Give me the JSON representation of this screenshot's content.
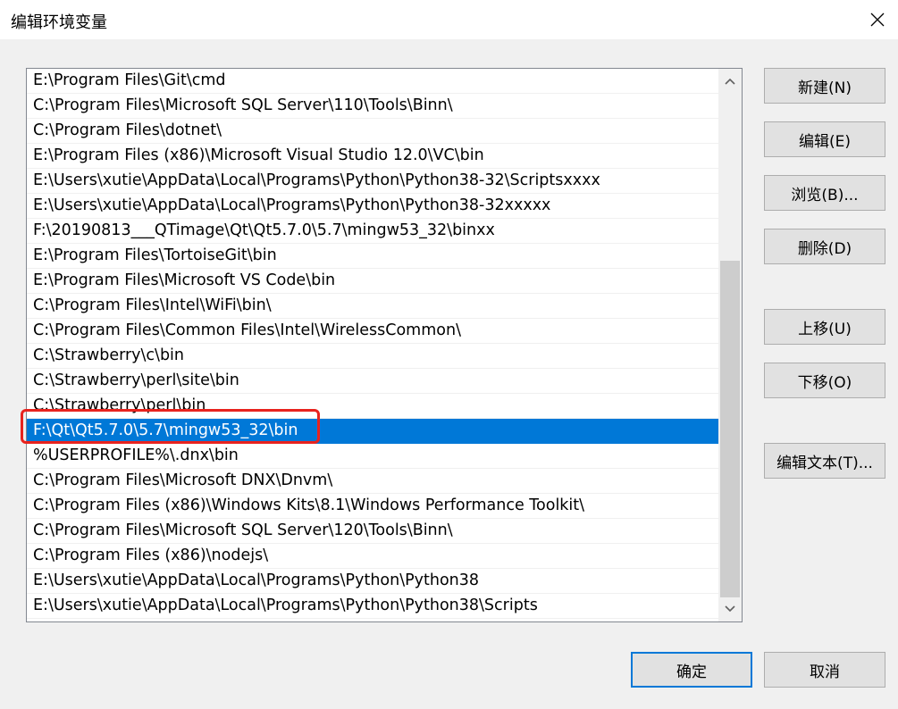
{
  "window": {
    "title": "编辑环境变量"
  },
  "list": {
    "items": [
      "E:\\Program Files\\Git\\cmd",
      "C:\\Program Files\\Microsoft SQL Server\\110\\Tools\\Binn\\",
      "C:\\Program Files\\dotnet\\",
      "E:\\Program Files (x86)\\Microsoft Visual Studio 12.0\\VC\\bin",
      "E:\\Users\\xutie\\AppData\\Local\\Programs\\Python\\Python38-32\\Scriptsxxxx",
      "E:\\Users\\xutie\\AppData\\Local\\Programs\\Python\\Python38-32xxxxx",
      "F:\\20190813___QTimage\\Qt\\Qt5.7.0\\5.7\\mingw53_32\\binxx",
      "E:\\Program Files\\TortoiseGit\\bin",
      "E:\\Program Files\\Microsoft VS Code\\bin",
      "C:\\Program Files\\Intel\\WiFi\\bin\\",
      "C:\\Program Files\\Common Files\\Intel\\WirelessCommon\\",
      "C:\\Strawberry\\c\\bin",
      "C:\\Strawberry\\perl\\site\\bin",
      "C:\\Strawberry\\perl\\bin",
      "F:\\Qt\\Qt5.7.0\\5.7\\mingw53_32\\bin",
      "%USERPROFILE%\\.dnx\\bin",
      "C:\\Program Files\\Microsoft DNX\\Dnvm\\",
      "C:\\Program Files (x86)\\Windows Kits\\8.1\\Windows Performance Toolkit\\",
      "C:\\Program Files\\Microsoft SQL Server\\120\\Tools\\Binn\\",
      "C:\\Program Files (x86)\\nodejs\\",
      "E:\\Users\\xutie\\AppData\\Local\\Programs\\Python\\Python38",
      "E:\\Users\\xutie\\AppData\\Local\\Programs\\Python\\Python38\\Scripts"
    ],
    "selected_index": 14
  },
  "buttons": {
    "new": "新建(N)",
    "edit": "编辑(E)",
    "browse": "浏览(B)...",
    "delete": "删除(D)",
    "move_up": "上移(U)",
    "move_down": "下移(O)",
    "edit_text": "编辑文本(T)...",
    "ok": "确定",
    "cancel": "取消"
  },
  "colors": {
    "selection": "#0078d7",
    "annotation": "#e8231e",
    "background": "#f0f0f0"
  },
  "icons": {
    "close": "close-icon",
    "scroll_up": "chevron-up-icon",
    "scroll_down": "chevron-down-icon"
  }
}
